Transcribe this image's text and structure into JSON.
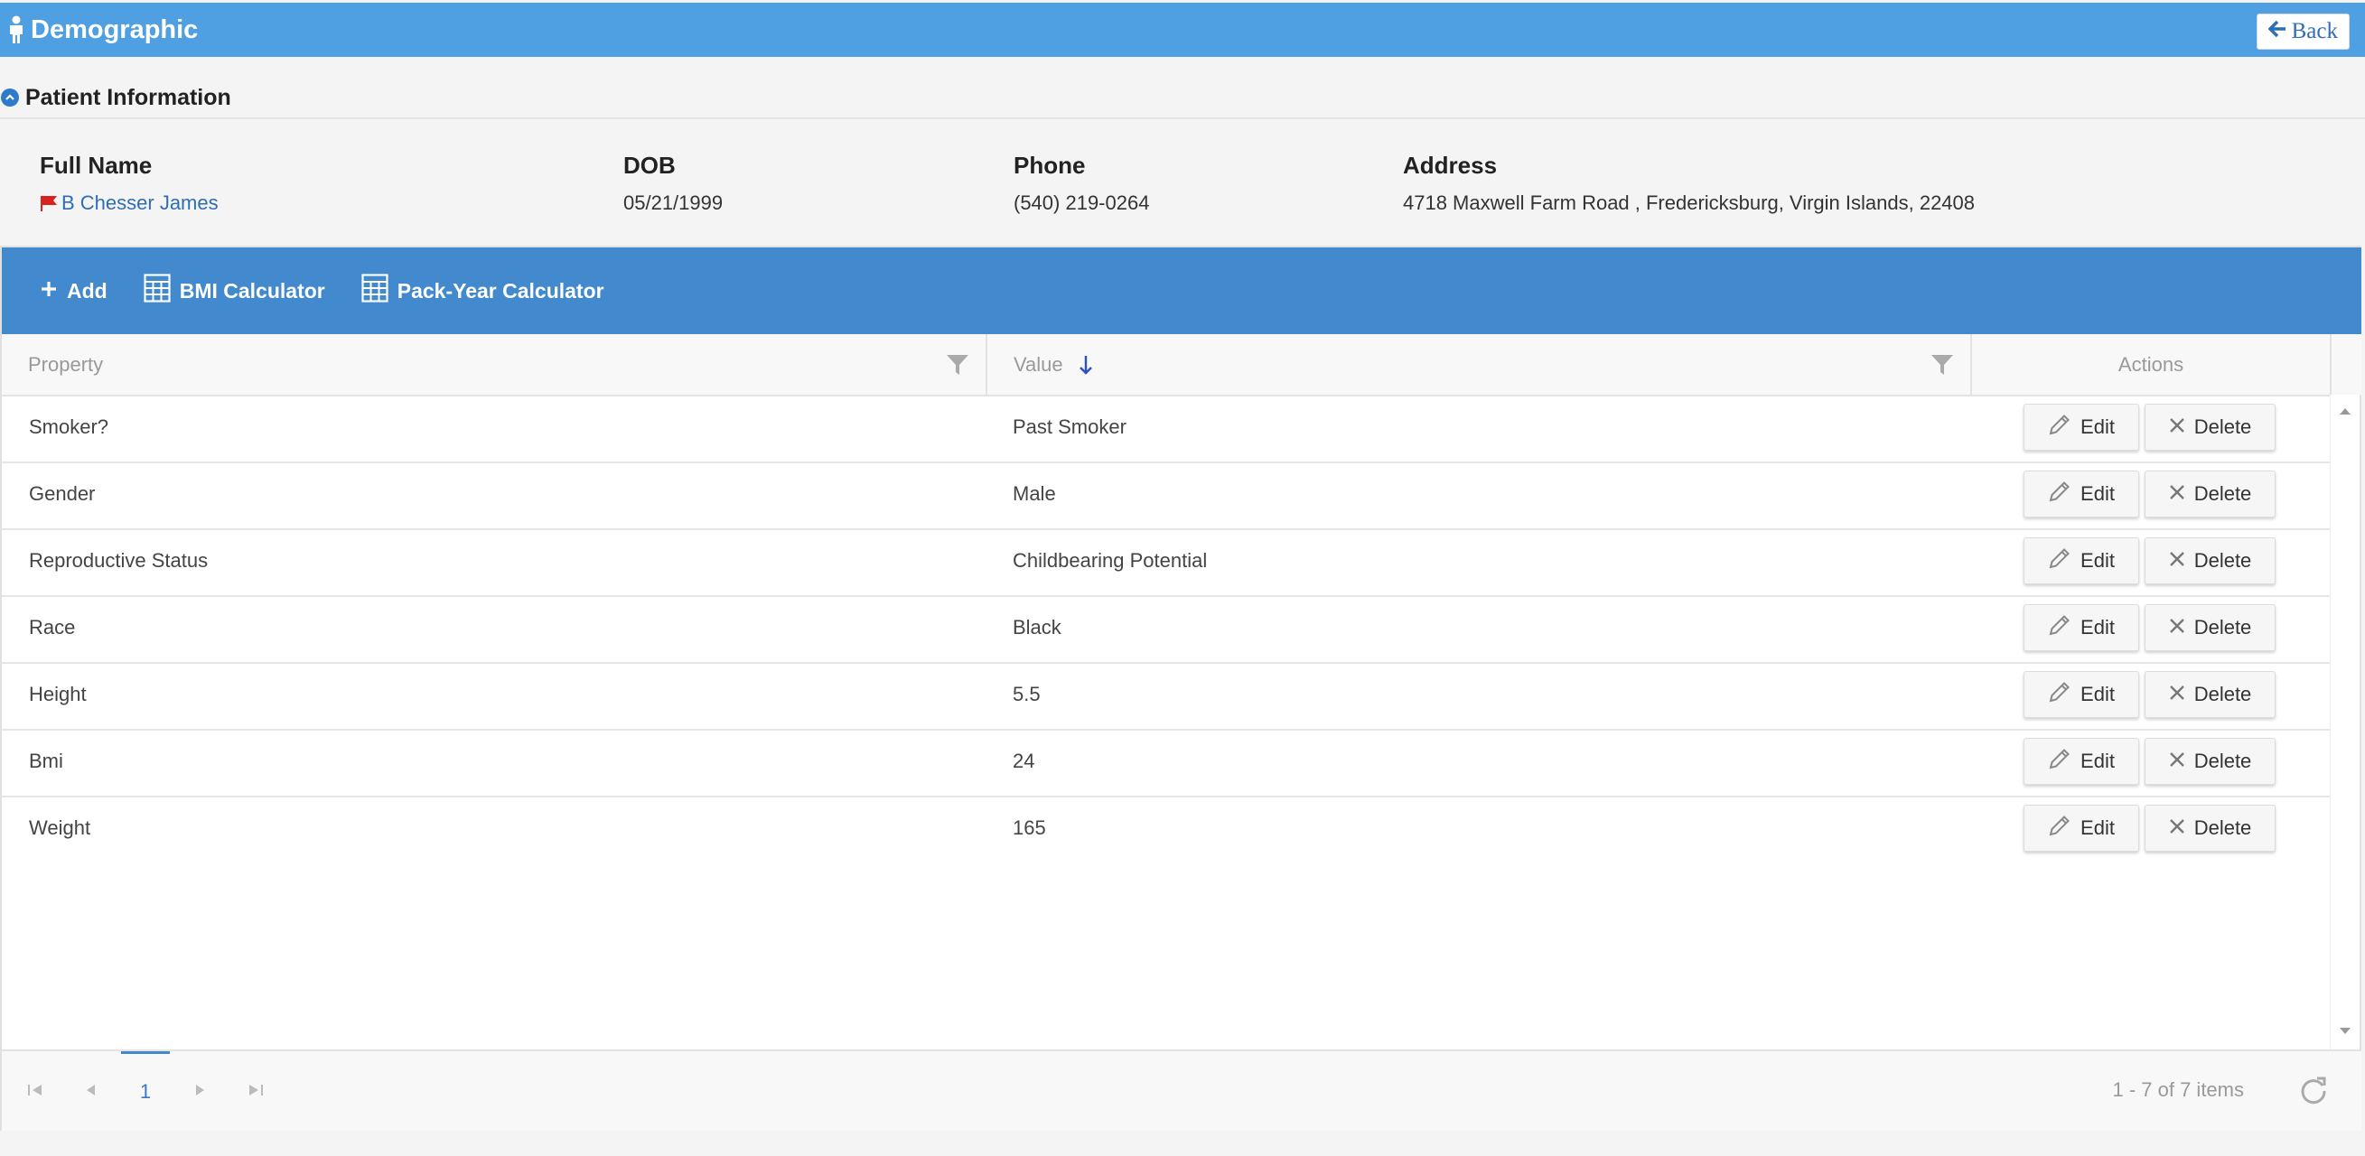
{
  "header": {
    "title": "Demographic",
    "back_label": "Back"
  },
  "section": {
    "title": "Patient Information"
  },
  "patient": {
    "full_name_label": "Full Name",
    "full_name": "B Chesser James",
    "dob_label": "DOB",
    "dob": "05/21/1999",
    "phone_label": "Phone",
    "phone": "(540) 219-0264",
    "address_label": "Address",
    "address": "4718 Maxwell Farm Road , Fredericksburg, Virgin Islands, 22408"
  },
  "toolbar": {
    "add_label": "Add",
    "bmi_label": "BMI Calculator",
    "pack_year_label": "Pack-Year Calculator"
  },
  "grid": {
    "columns": {
      "property": "Property",
      "value": "Value",
      "actions": "Actions"
    },
    "edit_label": "Edit",
    "delete_label": "Delete",
    "rows": [
      {
        "property": "Smoker?",
        "value": "Past Smoker"
      },
      {
        "property": "Gender",
        "value": "Male"
      },
      {
        "property": "Reproductive Status",
        "value": "Childbearing Potential"
      },
      {
        "property": "Race",
        "value": "Black"
      },
      {
        "property": "Height",
        "value": "5.5"
      },
      {
        "property": "Bmi",
        "value": "24"
      },
      {
        "property": "Weight",
        "value": "165"
      }
    ]
  },
  "pager": {
    "current_page": "1",
    "info": "1 - 7 of 7 items"
  },
  "colors": {
    "header_blue": "#4f9fe3",
    "toolbar_blue": "#4289ce",
    "link_blue": "#2f6db5",
    "flag_red": "#d9221f"
  }
}
